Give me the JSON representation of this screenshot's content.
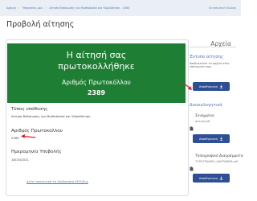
{
  "breadcrumb": {
    "items": [
      "Αρχική",
      "Υπηρεσίες μου",
      "Αίτηση Βεβαίωσης για Μισθοδοσία και Υδροδότηση - 1064"
    ],
    "right_text": "Εκτυπωτική έκδοση"
  },
  "page": {
    "title": "Προβολή αίτησης"
  },
  "success": {
    "line1": "Η αίτησή σας",
    "line2": "πρωτοκολλήθηκε",
    "protocol_label": "Αριθμός Πρωτοκόλλου",
    "protocol_number": "2389"
  },
  "details": {
    "type_label": "Τύπος υπόθεσης",
    "type_value": "Αίτηση Βεβαίωσης για Μισθοδοσία και Υδροδότηση",
    "protocol_label": "Αριθμός Πρωτοκόλλου",
    "protocol_value": "2389",
    "date_label": "Ημερομηνία Υποβολής",
    "date_value": "18/10/2021",
    "link_text": "Δείτε αναλυτικά τη διαδικασία εξέλιξης"
  },
  "sidebar": {
    "title": "Αρχεία",
    "section1_heading": "Έντυπο αίτησης",
    "section1_text": "Αποθηκεύστε το αρχείο στον υπολογιστή σας.",
    "download_label": "Αποθήκευση",
    "section2_heading": "Δικαιολογητικά",
    "attach_label": "Συνημμένο",
    "attach_file": "αιτηση.pdf",
    "sig_label": "Τοπογραφικό Διαγράμματα",
    "sig_file": "ΤΟΠΟΓΡΑΦΙΚΟ_ΔΙΑΓΡΑΜΜΑ.pdf"
  },
  "colors": {
    "success_green": "#1e7e34",
    "button_blue": "#2e4f93",
    "link_blue": "#4a78b8",
    "arrow_red": "#d9232d"
  }
}
